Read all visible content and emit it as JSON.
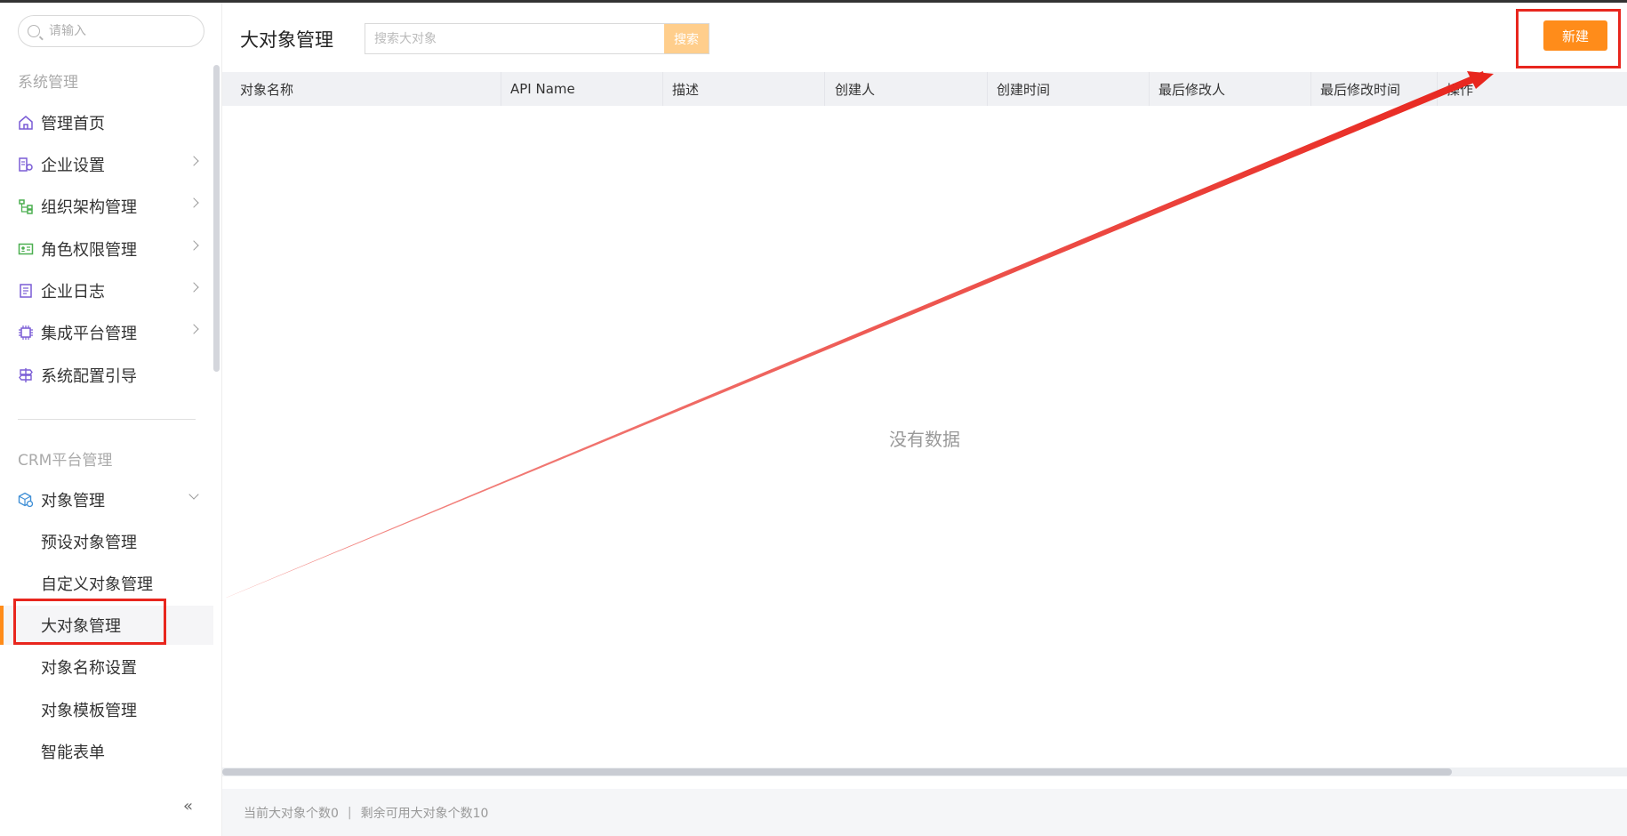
{
  "sidebar": {
    "search_placeholder": "请输入",
    "sections": {
      "system": "系统管理",
      "crm": "CRM平台管理"
    },
    "items": [
      {
        "label": "管理首页",
        "icon": "home-icon"
      },
      {
        "label": "企业设置",
        "icon": "building-icon"
      },
      {
        "label": "组织架构管理",
        "icon": "org-tree-icon"
      },
      {
        "label": "角色权限管理",
        "icon": "id-card-icon"
      },
      {
        "label": "企业日志",
        "icon": "log-document-icon"
      },
      {
        "label": "集成平台管理",
        "icon": "chip-icon"
      },
      {
        "label": "系统配置引导",
        "icon": "signpost-icon"
      },
      {
        "label": "对象管理",
        "icon": "cube-gear-icon"
      }
    ],
    "sub_items": [
      {
        "label": "预设对象管理"
      },
      {
        "label": "自定义对象管理"
      },
      {
        "label": "大对象管理"
      },
      {
        "label": "对象名称设置"
      },
      {
        "label": "对象模板管理"
      },
      {
        "label": "智能表单"
      }
    ],
    "collapse_label": "«"
  },
  "main": {
    "title": "大对象管理",
    "search_placeholder": "搜索大对象",
    "search_button": "搜索",
    "new_button": "新建",
    "columns": [
      "对象名称",
      "API Name",
      "描述",
      "创建人",
      "创建时间",
      "最后修改人",
      "最后修改时间",
      "操作"
    ],
    "empty_text": "没有数据",
    "footer": {
      "current": "当前大对象个数0",
      "separator": "|",
      "remaining": "剩余可用大对象个数10"
    }
  },
  "colors": {
    "accent": "#ff8c1a",
    "annotation": "#e8261e"
  }
}
